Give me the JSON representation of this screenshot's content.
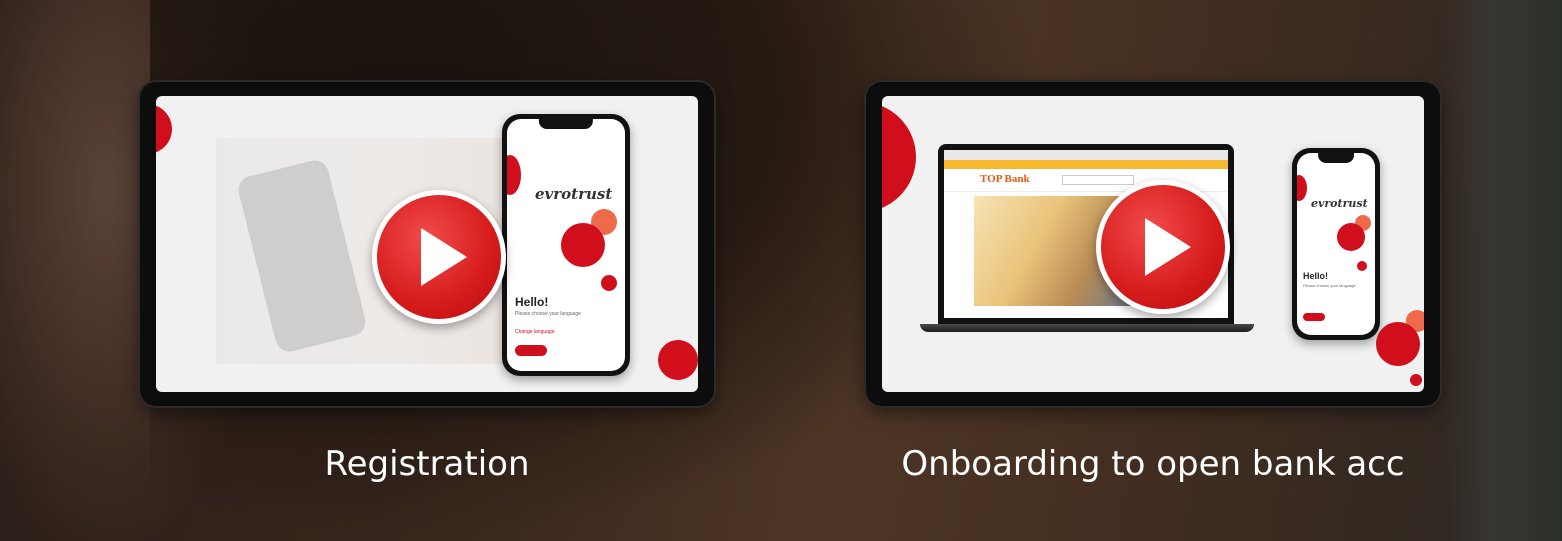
{
  "videos": [
    {
      "caption": "Registration",
      "phone": {
        "logo": "evrotrust",
        "greeting": "Hello!",
        "subtitle": "Please choose your language",
        "link": "Change language"
      }
    },
    {
      "caption": "Onboarding to open bank acc",
      "laptop": {
        "site_logo": "TOP Bank"
      },
      "phone": {
        "logo": "evrotrust",
        "greeting": "Hello!",
        "subtitle": "Please choose your language"
      }
    }
  ],
  "colors": {
    "accent": "#d10f1c",
    "accent_light": "#ef6a4b",
    "caption_text": "#ffffff"
  },
  "icons": {
    "play": "play-icon"
  }
}
